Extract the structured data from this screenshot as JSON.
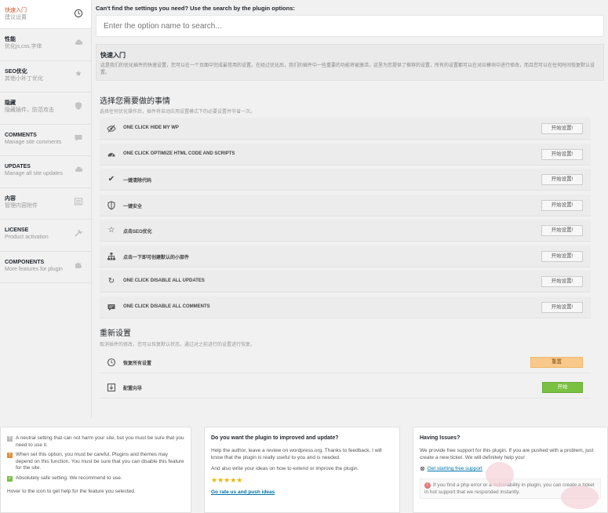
{
  "sidebar": {
    "items": [
      {
        "title": "快速入门",
        "sub": "建议设置",
        "icon": "clock-icon"
      },
      {
        "title": "性能",
        "sub": "优化js,css,字体",
        "icon": "cloud-icon"
      },
      {
        "title": "SEO优化",
        "sub": "其他小补丁优化",
        "icon": "star-icon"
      },
      {
        "title": "隐藏",
        "sub": "隐藏插件，防范攻击",
        "icon": "shield-icon"
      },
      {
        "title": "COMMENTS",
        "sub": "Manage site comments",
        "icon": "comment-icon"
      },
      {
        "title": "UPDATES",
        "sub": "Manage all site updates",
        "icon": "cloud-icon"
      },
      {
        "title": "内容",
        "sub": "管理内容附件",
        "icon": "list-icon"
      },
      {
        "title": "LICENSE",
        "sub": "Product activation",
        "icon": "wrench-icon"
      },
      {
        "title": "COMPONENTS",
        "sub": "More features for plugin",
        "icon": "puzzle-icon"
      }
    ]
  },
  "search": {
    "hint": "Can't find the settings you need? Use the search by the plugin options:",
    "placeholder": "Enter the option name to search..."
  },
  "quick": {
    "title": "快速入门",
    "desc": "这是我们的优化插件的快速设置，您可以在一个页面中完成最常用的设置。在经过优化后，我们的插件中一些重要的功能将被激活，这里为您提供了推荐的设置，所有的设置都可以在对应模块中进行修改，而且您可以在任何时间恢复默认设置。"
  },
  "quickActions": {
    "title": "选择您需要做的事情",
    "desc": "选择任何优化操作后，插件将自动应用设置模式下的必要设置并节省一次。",
    "rows": [
      {
        "icon": "eye-slash-icon",
        "label": "ONE CLICK HIDE MY WP",
        "button": "开始设置!"
      },
      {
        "icon": "dashboard-icon",
        "label": "ONE CLICK OPTIMIZE HTML CODE AND SCRIPTS",
        "button": "开始设置!"
      },
      {
        "icon": "check-icon",
        "label": "一键清除代码",
        "button": "开始设置!"
      },
      {
        "icon": "shield-icon",
        "label": "一键安全",
        "button": "开始设置!"
      },
      {
        "icon": "star-icon",
        "label": "点击SEO优化",
        "button": "开始设置!"
      },
      {
        "icon": "sitemap-icon",
        "label": "点击一下即可创建默认的小部件",
        "button": "开始设置!"
      },
      {
        "icon": "refresh-icon",
        "label": "ONE CLICK DISABLE ALL UPDATES",
        "button": "开始设置!"
      },
      {
        "icon": "comment-icon",
        "label": "ONE CLICK DISABLE ALL COMMENTS",
        "button": "开始设置!"
      }
    ]
  },
  "reset": {
    "title": "重新设置",
    "desc": "取消插件的修改，您可以恢复默认状态，通过对之前进行的设置进行恢复。",
    "rows": [
      {
        "icon": "history-icon",
        "label": "恢复所有设置",
        "button": "重置",
        "color": "#f8c98a"
      },
      {
        "icon": "import-icon",
        "label": "配置向导",
        "button": "开始",
        "color": "#7ac142"
      }
    ]
  },
  "legend": {
    "items": [
      {
        "mark": "?",
        "color": "#bbbbbb",
        "text": "A neutral setting that can not harm your site, but you must be sure that you need to use it."
      },
      {
        "mark": "!",
        "color": "#e58e3a",
        "text": "When set this option, you must be careful. Plugins and themes may depend on this function. You must be sure that you can disable this feature for the site."
      },
      {
        "mark": "✓",
        "color": "#7ac142",
        "text": "Absolutely safe setting. We recommend to use."
      }
    ],
    "hover_hint": "Hover to the icon to get help for the feature you selected."
  },
  "feedback": {
    "title": "Do you want the plugin to improved and update?",
    "p1": "Help the author, leave a review on wordpress.org. Thanks to feedback, I will know that the plugin is really useful to you and is needed.",
    "p2": "And also write your ideas on how to extend or improve the plugin.",
    "stars": "★★★★★",
    "link": "Go rate us and push ideas"
  },
  "support": {
    "title": "Having Issues?",
    "p1": "We provide free support for this plugin. If you are pushed with a problem, just create a new ticket. We will definitely help you!",
    "link": "Get starting free support",
    "warn": "If you find a php error or a vulnerability in plugin, you can create a ticket in hot support that we responded instantly."
  }
}
